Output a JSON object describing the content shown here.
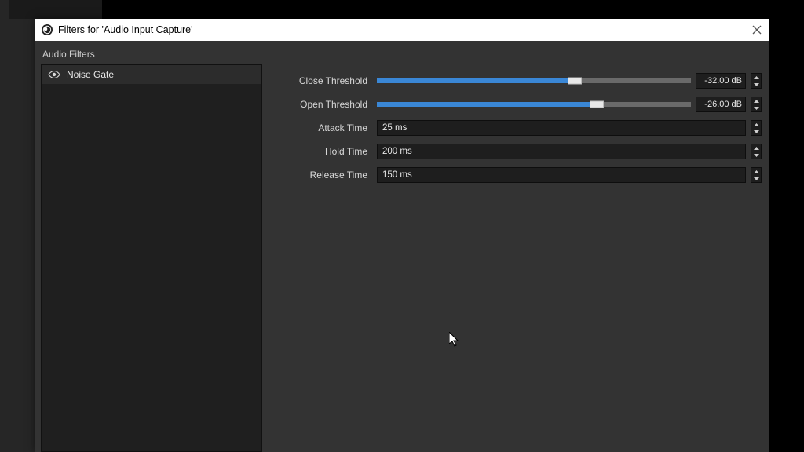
{
  "window": {
    "title": "Filters for 'Audio Input Capture'"
  },
  "section": {
    "header": "Audio Filters"
  },
  "sidebar": {
    "items": [
      {
        "label": "Noise Gate",
        "icon": "eye-icon"
      }
    ]
  },
  "settings": {
    "close_threshold": {
      "label": "Close Threshold",
      "value_display": "-32.00 dB",
      "fill_pct": 62,
      "thumb_pct": 63
    },
    "open_threshold": {
      "label": "Open Threshold",
      "value_display": "-26.00 dB",
      "fill_pct": 69,
      "thumb_pct": 70
    },
    "attack_time": {
      "label": "Attack Time",
      "value_display": "25 ms"
    },
    "hold_time": {
      "label": "Hold Time",
      "value_display": "200 ms"
    },
    "release_time": {
      "label": "Release Time",
      "value_display": "150 ms"
    }
  }
}
